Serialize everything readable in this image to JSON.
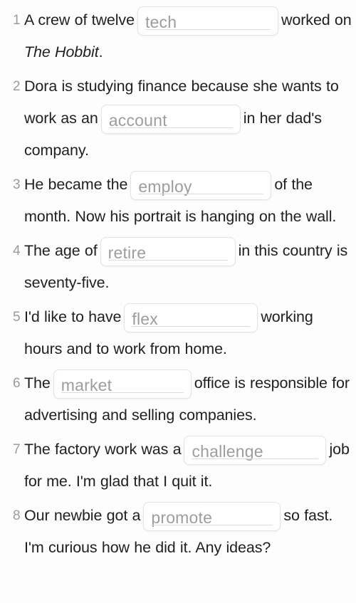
{
  "exercise": {
    "type": "gap-fill",
    "total_items": 8,
    "colors": {
      "background": "#fdfdfd",
      "body_text": "#1f1f1f",
      "number": "#9b9b9b",
      "input_text": "#9d9d9d",
      "input_border": "#e4e4e4",
      "input_rule": "#dcdcdc",
      "input_background": "#ffffff"
    },
    "items": [
      {
        "number": "1",
        "before": "A crew of twelve",
        "input_value": "tech",
        "after_plain": "",
        "after_html": "worked on <em>The Hobbit</em>.",
        "after_text": "worked on The Hobbit."
      },
      {
        "number": "2",
        "before": "Dora is studying finance because she wants to work as an",
        "input_value": "account",
        "after_plain": "in her dad's company.",
        "after_html": "in her dad's company.",
        "after_text": "in her dad's company."
      },
      {
        "number": "3",
        "before": "He became the",
        "input_value": "employ",
        "after_plain": "of the month. Now his portrait is hanging on the wall.",
        "after_html": "of the month. Now his portrait is hanging on the wall.",
        "after_text": "of the month. Now his portrait is hanging on the wall."
      },
      {
        "number": "4",
        "before": "The age of",
        "input_value": "retire",
        "after_plain": "in this country is seventy-five.",
        "after_html": "in this country is seventy-five.",
        "after_text": "in this country is seventy-five."
      },
      {
        "number": "5",
        "before": "I'd like to have",
        "input_value": "flex",
        "after_plain": "working hours and to work from home.",
        "after_html": "working hours and to work from home.",
        "after_text": "working hours and to work from home."
      },
      {
        "number": "6",
        "before": "The",
        "input_value": "market",
        "after_plain": "office is responsible for advertising and selling companies.",
        "after_html": "office is responsible for advertising and selling companies.",
        "after_text": "office is responsible for advertising and selling companies."
      },
      {
        "number": "7",
        "before": "The factory work was a",
        "input_value": "challenge",
        "after_plain": "job for me. I'm glad that I quit it.",
        "after_html": "job for me. I'm glad that I quit it.",
        "after_text": "job for me. I'm glad that I quit it."
      },
      {
        "number": "8",
        "before": "Our newbie got a",
        "input_value": "promote",
        "after_plain": "so fast. I'm curious how he did it. Any ideas?",
        "after_html": "so fast. I'm curious how he did it. Any ideas?",
        "after_text": "so fast. I'm curious how he did it. Any ideas?"
      }
    ]
  }
}
